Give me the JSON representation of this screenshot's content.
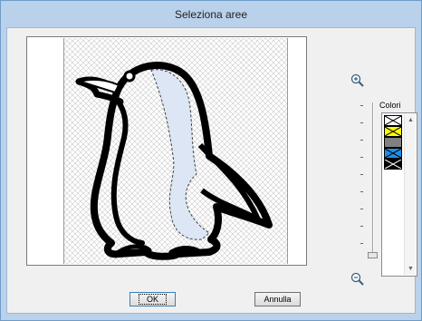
{
  "window": {
    "title": "Seleziona aree"
  },
  "colors_panel": {
    "label": "Colori",
    "swatches": [
      {
        "name": "no-color",
        "color": "#ffffff",
        "crossed": true
      },
      {
        "name": "yellow",
        "color": "#ffff00",
        "crossed": true
      },
      {
        "name": "gray",
        "color": "#808080",
        "crossed": false
      },
      {
        "name": "blue",
        "color": "#1e8fe8",
        "crossed": true
      },
      {
        "name": "black",
        "color": "#000000",
        "crossed": true
      }
    ]
  },
  "zoom": {
    "in_icon": "zoom-in-magnifier",
    "out_icon": "zoom-out-magnifier",
    "level": 0
  },
  "buttons": {
    "ok": "OK",
    "cancel": "Annulla"
  },
  "colors": {
    "titlebar": "#b9d1ea",
    "selected_area": "#dce6f5",
    "outline": "#000000"
  }
}
